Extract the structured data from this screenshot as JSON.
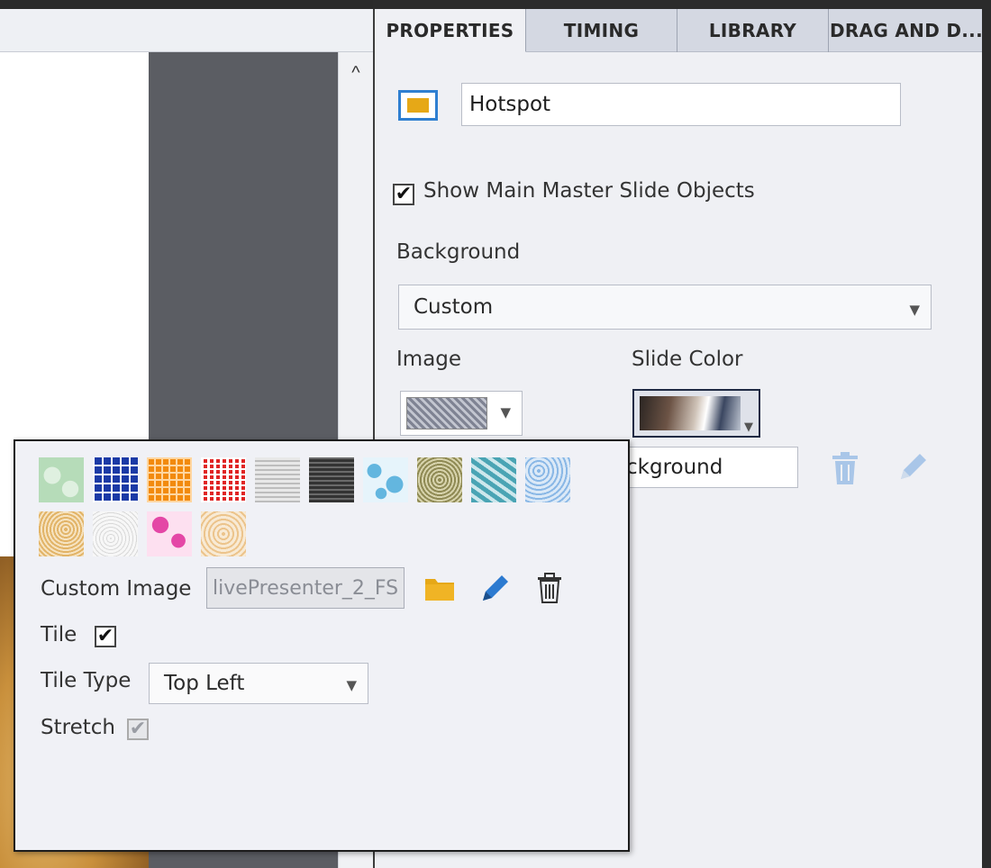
{
  "tabs": [
    {
      "label": "PROPERTIES",
      "active": true
    },
    {
      "label": "TIMING",
      "active": false
    },
    {
      "label": "LIBRARY",
      "active": false
    },
    {
      "label": "DRAG AND D...",
      "active": false
    }
  ],
  "object": {
    "icon": "hotspot-icon",
    "name": "Hotspot"
  },
  "master": {
    "label": "Show Main Master Slide Objects",
    "checked": true
  },
  "background": {
    "label": "Background",
    "selected": "Custom",
    "image_label": "Image",
    "slide_color_label": "Slide Color",
    "name_value": "ckground"
  },
  "popup": {
    "swatch_colors": [
      [
        "#dff0e0",
        "#b6dcb9"
      ],
      [
        "#1b3aa6",
        "#ffffff"
      ],
      [
        "#f28a0e",
        "#ffd6a0"
      ],
      [
        "#e02424",
        "#ffffff"
      ],
      [
        "#bdbdbd",
        "#e8e8e8"
      ],
      [
        "#333333",
        "#6a6a6a"
      ],
      [
        "#63b6df",
        "#e6f4fb"
      ],
      [
        "#8f8a54",
        "#d7d3ac"
      ],
      [
        "#4aa4b4",
        "#cce7ec"
      ],
      [
        "#8ab8e6",
        "#dbe9f7"
      ],
      [
        "#e2b468",
        "#f6e3c1"
      ],
      [
        "#d8d8d8",
        "#f7f7f7"
      ],
      [
        "#e447a6",
        "#fde0f0"
      ],
      [
        "#ecc48c",
        "#f8ead4"
      ]
    ],
    "custom_image_label": "Custom Image",
    "custom_image_value": "livePresenter_2_FS",
    "tile_label": "Tile",
    "tile_checked": true,
    "tile_type_label": "Tile Type",
    "tile_type_value": "Top Left",
    "stretch_label": "Stretch",
    "stretch_checked": true
  },
  "icons": {
    "folder": "folder-icon",
    "pencil": "pencil-icon",
    "trash": "trash-icon",
    "caret": "▼",
    "scroll_up": "^"
  },
  "colors": {
    "accent_blue": "#2f7fd1",
    "folder_yellow": "#e6a817",
    "pencil_blue": "#2c7ad0",
    "pasteboard": "#5b5d63"
  }
}
